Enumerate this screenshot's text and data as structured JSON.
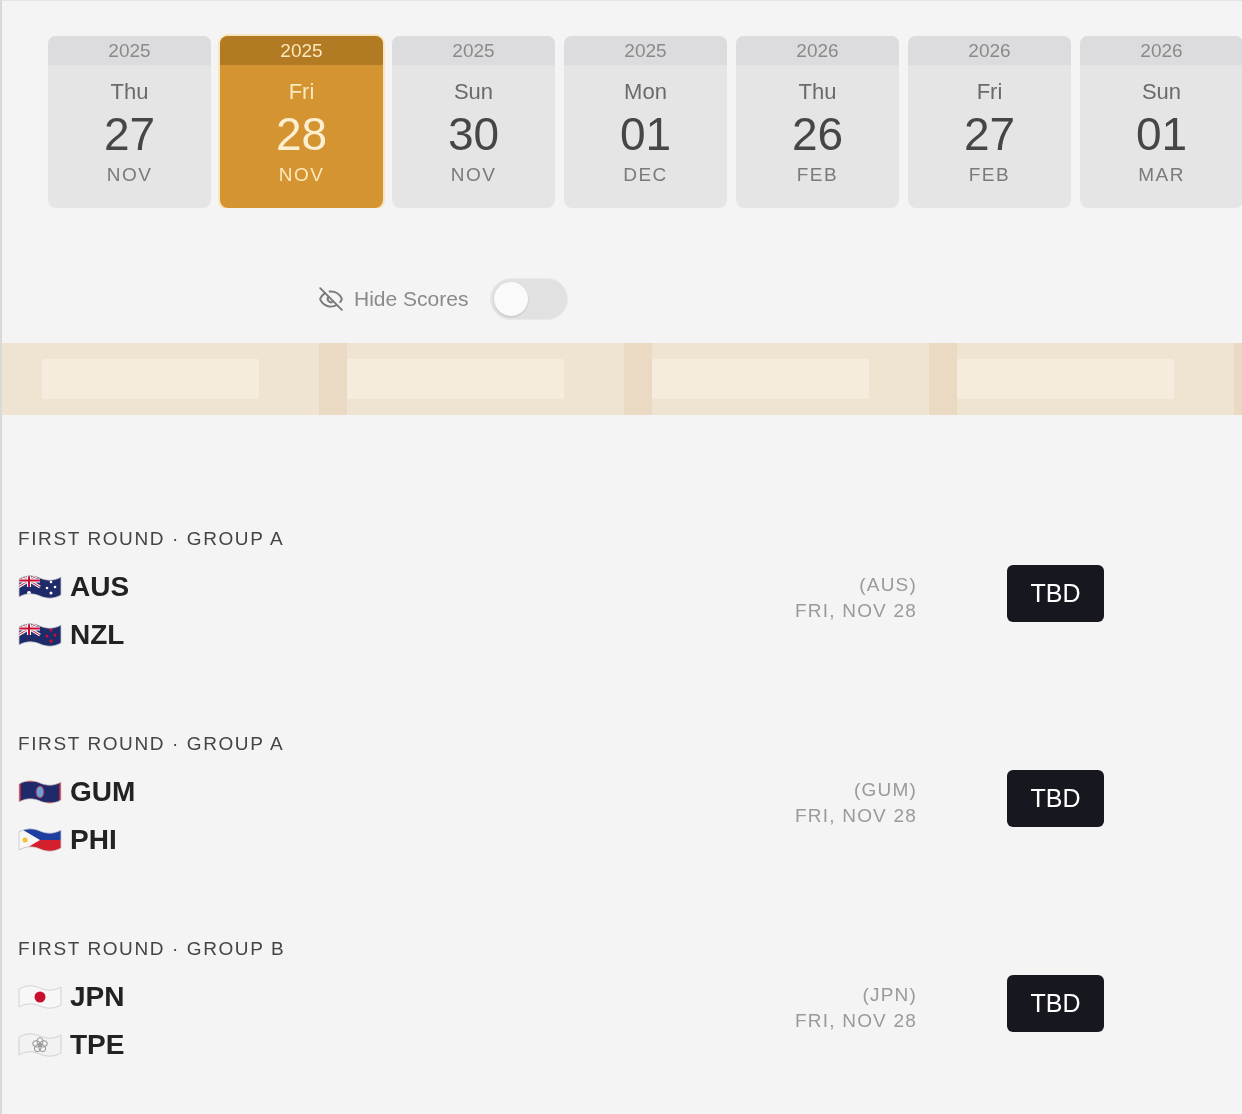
{
  "date_tabs": [
    {
      "year": "2025",
      "weekday": "Thu",
      "day": "27",
      "month": "NOV",
      "selected": false
    },
    {
      "year": "2025",
      "weekday": "Fri",
      "day": "28",
      "month": "NOV",
      "selected": true
    },
    {
      "year": "2025",
      "weekday": "Sun",
      "day": "30",
      "month": "NOV",
      "selected": false
    },
    {
      "year": "2025",
      "weekday": "Mon",
      "day": "01",
      "month": "DEC",
      "selected": false
    },
    {
      "year": "2026",
      "weekday": "Thu",
      "day": "26",
      "month": "FEB",
      "selected": false
    },
    {
      "year": "2026",
      "weekday": "Fri",
      "day": "27",
      "month": "FEB",
      "selected": false
    },
    {
      "year": "2026",
      "weekday": "Sun",
      "day": "01",
      "month": "MAR",
      "selected": false
    }
  ],
  "hide_scores": {
    "label": "Hide Scores",
    "on": false
  },
  "matches": [
    {
      "round": "FIRST ROUND · GROUP A",
      "teams": [
        {
          "code": "AUS",
          "kind": "australia"
        },
        {
          "code": "NZL",
          "kind": "newzealand"
        }
      ],
      "venue": "(AUS)",
      "date": "FRI, NOV 28",
      "status": "TBD"
    },
    {
      "round": "FIRST ROUND · GROUP A",
      "teams": [
        {
          "code": "GUM",
          "kind": "guam"
        },
        {
          "code": "PHI",
          "kind": "philippines"
        }
      ],
      "venue": "(GUM)",
      "date": "FRI, NOV 28",
      "status": "TBD"
    },
    {
      "round": "FIRST ROUND · GROUP B",
      "teams": [
        {
          "code": "JPN",
          "kind": "japan"
        },
        {
          "code": "TPE",
          "kind": "taipei"
        }
      ],
      "venue": "(JPN)",
      "date": "FRI, NOV 28",
      "status": "TBD"
    }
  ]
}
